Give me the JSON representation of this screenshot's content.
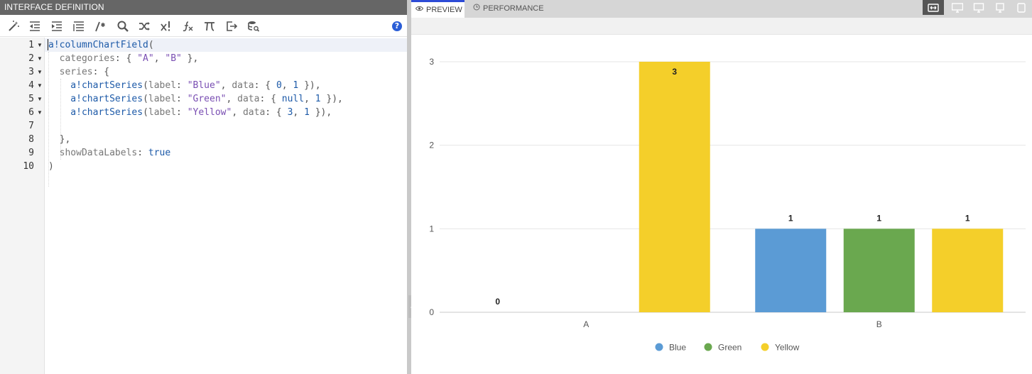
{
  "left_panel": {
    "title": "INTERFACE DEFINITION",
    "toolbar_icons": [
      "magic-wand-icon",
      "outdent-icon",
      "indent-icon",
      "format-icon",
      "comment-icon",
      "search-icon",
      "shuffle-icon",
      "expression-icon",
      "function-icon",
      "pi-icon",
      "export-icon",
      "database-search-icon"
    ],
    "help": "?"
  },
  "code": {
    "line_numbers": [
      "1",
      "2",
      "3",
      "4",
      "5",
      "6",
      "7",
      "8",
      "9",
      "10"
    ],
    "lines": [
      [
        {
          "t": "fn",
          "v": "a!columnChartField"
        },
        {
          "t": "punc",
          "v": "("
        }
      ],
      [
        {
          "t": "key",
          "v": "  categories"
        },
        {
          "t": "punc",
          "v": ": { "
        },
        {
          "t": "str",
          "v": "\"A\""
        },
        {
          "t": "punc",
          "v": ", "
        },
        {
          "t": "str",
          "v": "\"B\""
        },
        {
          "t": "punc",
          "v": " },"
        }
      ],
      [
        {
          "t": "key",
          "v": "  series"
        },
        {
          "t": "punc",
          "v": ": {"
        }
      ],
      [
        {
          "t": "fn",
          "v": "    a!chartSeries"
        },
        {
          "t": "punc",
          "v": "("
        },
        {
          "t": "key",
          "v": "label"
        },
        {
          "t": "punc",
          "v": ": "
        },
        {
          "t": "str",
          "v": "\"Blue\""
        },
        {
          "t": "punc",
          "v": ", "
        },
        {
          "t": "key",
          "v": "data"
        },
        {
          "t": "punc",
          "v": ": { "
        },
        {
          "t": "num",
          "v": "0"
        },
        {
          "t": "punc",
          "v": ", "
        },
        {
          "t": "num",
          "v": "1"
        },
        {
          "t": "punc",
          "v": " }),"
        }
      ],
      [
        {
          "t": "fn",
          "v": "    a!chartSeries"
        },
        {
          "t": "punc",
          "v": "("
        },
        {
          "t": "key",
          "v": "label"
        },
        {
          "t": "punc",
          "v": ": "
        },
        {
          "t": "str",
          "v": "\"Green\""
        },
        {
          "t": "punc",
          "v": ", "
        },
        {
          "t": "key",
          "v": "data"
        },
        {
          "t": "punc",
          "v": ": { "
        },
        {
          "t": "kw",
          "v": "null"
        },
        {
          "t": "punc",
          "v": ", "
        },
        {
          "t": "num",
          "v": "1"
        },
        {
          "t": "punc",
          "v": " }),"
        }
      ],
      [
        {
          "t": "fn",
          "v": "    a!chartSeries"
        },
        {
          "t": "punc",
          "v": "("
        },
        {
          "t": "key",
          "v": "label"
        },
        {
          "t": "punc",
          "v": ": "
        },
        {
          "t": "str",
          "v": "\"Yellow\""
        },
        {
          "t": "punc",
          "v": ", "
        },
        {
          "t": "key",
          "v": "data"
        },
        {
          "t": "punc",
          "v": ": { "
        },
        {
          "t": "num",
          "v": "3"
        },
        {
          "t": "punc",
          "v": ", "
        },
        {
          "t": "num",
          "v": "1"
        },
        {
          "t": "punc",
          "v": " }),"
        }
      ],
      [],
      [
        {
          "t": "punc",
          "v": "  },"
        }
      ],
      [
        {
          "t": "key",
          "v": "  showDataLabels"
        },
        {
          "t": "punc",
          "v": ": "
        },
        {
          "t": "kw",
          "v": "true"
        }
      ],
      [
        {
          "t": "punc",
          "v": ")"
        }
      ]
    ],
    "foldable": [
      true,
      true,
      true,
      true,
      true,
      true,
      false,
      false,
      false,
      false
    ]
  },
  "right_panel": {
    "tabs": [
      {
        "label": "PREVIEW",
        "icon": "eye-icon",
        "active": true
      },
      {
        "label": "PERFORMANCE",
        "icon": "clock-icon",
        "active": false
      }
    ],
    "device_buttons": [
      "fit-width-icon",
      "desktop-large-icon",
      "desktop-icon",
      "monitor-small-icon",
      "tablet-icon"
    ]
  },
  "chart_data": {
    "type": "bar",
    "categories": [
      "A",
      "B"
    ],
    "series": [
      {
        "name": "Blue",
        "color": "#5b9bd5",
        "values": [
          0,
          1
        ]
      },
      {
        "name": "Green",
        "color": "#6aa84f",
        "values": [
          null,
          1
        ]
      },
      {
        "name": "Yellow",
        "color": "#f4cf2a",
        "values": [
          3,
          1
        ]
      }
    ],
    "ylim": [
      0,
      3
    ],
    "yticks": [
      "0",
      "1",
      "2",
      "3"
    ],
    "show_data_labels": true,
    "grid": true,
    "legend_position": "bottom"
  }
}
